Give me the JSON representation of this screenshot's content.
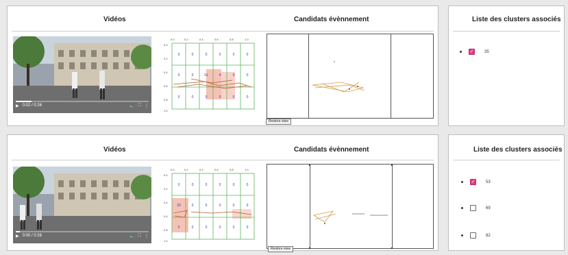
{
  "rows": [
    {
      "videos_header": "Vidéos",
      "candidates_header": "Candidats évènnement",
      "clusters_header": "Liste des clusters associés",
      "video_time": "0:02 / 0:26",
      "restore_label": "Restore view",
      "grid": {
        "x_ticks": [
          "0.0",
          "0.2",
          "0.4",
          "0.6",
          "0.8",
          "1.0"
        ],
        "y_ticks": [
          "0.0",
          "0.2",
          "0.4",
          "0.6",
          "0.8",
          "1.0"
        ],
        "counts": [
          [
            "0",
            "0",
            "0",
            "0",
            "0",
            "0"
          ],
          [
            "0",
            "0",
            "51",
            "4",
            "0",
            "0"
          ],
          [
            "0",
            "0",
            "0",
            "0",
            "0",
            "0"
          ]
        ]
      },
      "clusters": [
        {
          "id": "35",
          "checked": true
        }
      ]
    },
    {
      "videos_header": "Vidéos",
      "candidates_header": "Candidats évènnement",
      "clusters_header": "Liste des clusters associés",
      "video_time": "0:00 / 0:26",
      "restore_label": "Restore view",
      "grid": {
        "x_ticks": [
          "0.0",
          "0.2",
          "0.4",
          "0.6",
          "0.8",
          "1.0"
        ],
        "y_ticks": [
          "0.0",
          "0.2",
          "0.4",
          "0.6",
          "0.8",
          "1.0"
        ],
        "counts": [
          [
            "0",
            "0",
            "0",
            "0",
            "0",
            "0"
          ],
          [
            "20",
            "0",
            "0",
            "0",
            "0",
            "0"
          ],
          [
            "0",
            "0",
            "0",
            "0",
            "0",
            "0"
          ]
        ]
      },
      "clusters": [
        {
          "id": "53",
          "checked": true
        },
        {
          "id": "69",
          "checked": false
        },
        {
          "id": "82",
          "checked": false
        }
      ]
    }
  ]
}
